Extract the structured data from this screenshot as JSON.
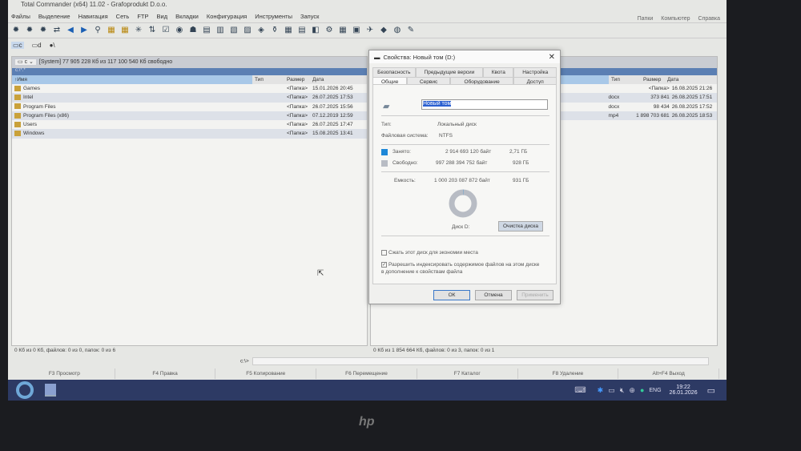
{
  "window": {
    "title": "Total Commander (x64) 11.02 - Grafoprodukt D.o.o."
  },
  "menu": [
    "Файлы",
    "Выделение",
    "Навигация",
    "Сеть",
    "FTP",
    "Вид",
    "Вкладки",
    "Конфигурация",
    "Инструменты",
    "Запуск"
  ],
  "right_menu": [
    "Папки",
    "Компьютер",
    "Справка"
  ],
  "drives": [
    "c",
    "d",
    "\\"
  ],
  "left_panel": {
    "drive": "c",
    "path_info": "[System]  77 905 228 Кб из 117 100 540 Кб свободно",
    "filter": "c:\\*.*",
    "headers": [
      "↑Имя",
      "Тип",
      "Размер",
      "Дата"
    ],
    "rows": [
      {
        "name": "Games",
        "size": "<Папка>",
        "date": "15.01.2026 20:45"
      },
      {
        "name": "Intel",
        "size": "<Папка>",
        "date": "26.07.2025 17:53"
      },
      {
        "name": "Program Files",
        "size": "<Папка>",
        "date": "26.07.2025 15:56"
      },
      {
        "name": "Program Files (x86)",
        "size": "<Папка>",
        "date": "07.12.2019 12:59"
      },
      {
        "name": "Users",
        "size": "<Папка>",
        "date": "26.07.2025 17:47"
      },
      {
        "name": "Windows",
        "size": "<Папка>",
        "date": "15.08.2025 13:41"
      }
    ],
    "status": "0 Кб из 0 Кб, файлов: 0 из 0, папок: 0 из 6"
  },
  "right_panel": {
    "headers": [
      "Тип",
      "Размер",
      "Дата"
    ],
    "rows": [
      {
        "type": "",
        "size": "<Папка>",
        "date": "16.08.2025 21:26"
      },
      {
        "type": "docx",
        "size": "373 841",
        "date": "26.08.2025 17:51"
      },
      {
        "type": "docx",
        "size": "98 434",
        "date": "26.08.2025 17:52"
      },
      {
        "type": "mp4",
        "size": "1 898 703 681",
        "date": "26.08.2025 18:53"
      }
    ],
    "status": "0 Кб из 1 854 664 Кб, файлов: 0 из 3, папок: 0 из 1"
  },
  "cmd_prompt": "c:\\>",
  "fkeys": [
    "F3 Просмотр",
    "F4 Правка",
    "F5 Копирование",
    "F6 Перемещение",
    "F7 Каталог",
    "F8 Удаление",
    "Alt+F4 Выход"
  ],
  "dialog": {
    "title": "Свойства: Новый том (D:)",
    "tabs_top": [
      "Безопасность",
      "Предыдущие версии",
      "Квота",
      "Настройка"
    ],
    "tabs_bottom": [
      "Общие",
      "Сервис",
      "Оборудование",
      "Доступ"
    ],
    "volume_name": "Новый том",
    "type_label": "Тип:",
    "type_value": "Локальный диск",
    "fs_label": "Файловая система:",
    "fs_value": "NTFS",
    "used_label": "Занято:",
    "used_bytes": "2 914 693 120 байт",
    "used_gb": "2,71 ГБ",
    "free_label": "Свободно:",
    "free_bytes": "997 288 394 752 байт",
    "free_gb": "928 ГБ",
    "cap_label": "Емкость:",
    "cap_bytes": "1 000 203 087 872 байт",
    "cap_gb": "931 ГБ",
    "used_fraction": 0.003,
    "disk_label": "Диск D:",
    "cleanup": "Очистка диска",
    "compress": "Сжать этот диск для экономии места",
    "index": "Разрешить индексировать содержимое файлов на этом диске в дополнение к свойствам файла",
    "ok": "ОК",
    "cancel": "Отмена",
    "apply": "Применить",
    "used_color": "#1e88d8",
    "free_color": "#b8bcc4"
  },
  "tray": {
    "lang": "ENG",
    "time": "19:22",
    "date": "26.01.2026"
  },
  "bezel": {
    "logo": "hp"
  }
}
